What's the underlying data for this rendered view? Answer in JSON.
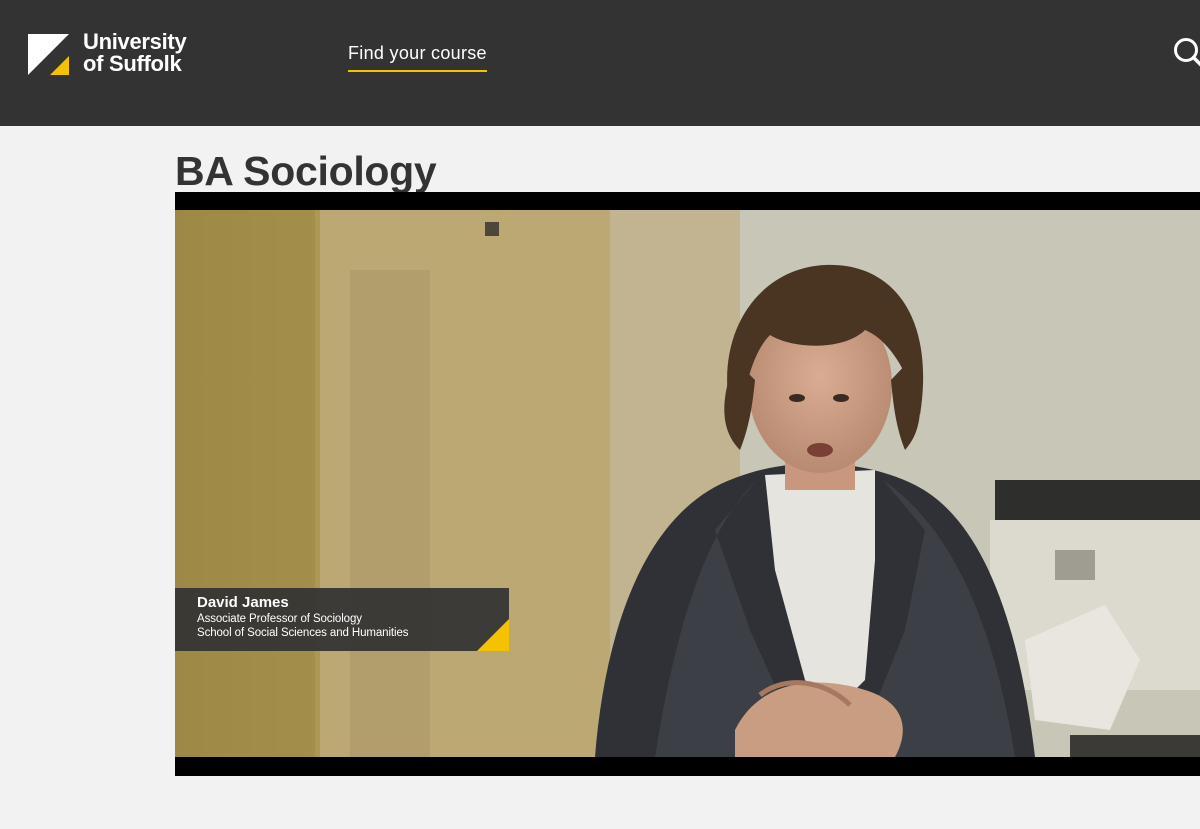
{
  "header": {
    "logo": {
      "line1": "University",
      "line2": "of Suffolk",
      "icon": "university-of-suffolk-logo-mark"
    },
    "nav": {
      "find_course": "Find your course"
    },
    "search": {
      "icon": "search-icon"
    }
  },
  "page": {
    "title": "BA Sociology"
  },
  "video": {
    "speaker_name": "David James",
    "speaker_role": "Associate Professor of Sociology",
    "speaker_school": "School of Social Sciences and Humanities"
  },
  "colors": {
    "header_bg": "#333333",
    "accent_yellow": "#f5c200",
    "page_bg": "#f2f2f2",
    "title_text": "#333333"
  }
}
